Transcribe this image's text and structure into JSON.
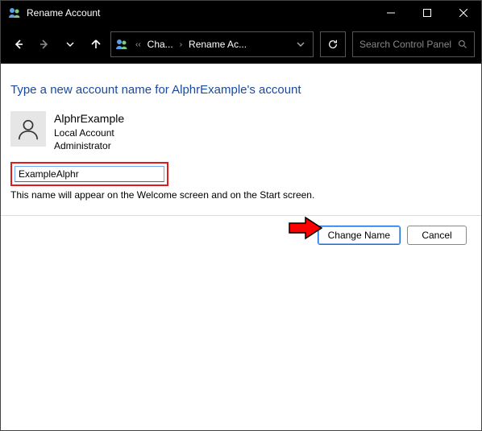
{
  "titlebar": {
    "title": "Rename Account"
  },
  "nav": {
    "crumb1": "Cha...",
    "crumb2": "Rename Ac..."
  },
  "search": {
    "placeholder": "Search Control Panel"
  },
  "page": {
    "heading": "Type a new account name for AlphrExample's account",
    "account_name": "AlphrExample",
    "account_type": "Local Account",
    "account_role": "Administrator",
    "new_name_value": "ExampleAlphr",
    "hint": "This name will appear on the Welcome screen and on the Start screen."
  },
  "buttons": {
    "change": "Change Name",
    "cancel": "Cancel"
  }
}
